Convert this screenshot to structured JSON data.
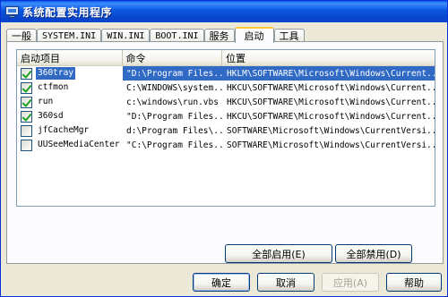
{
  "window": {
    "title": "系统配置实用程序"
  },
  "tabs": [
    {
      "label": "一般"
    },
    {
      "label": "SYSTEM.INI"
    },
    {
      "label": "WIN.INI"
    },
    {
      "label": "BOOT.INI"
    },
    {
      "label": "服务"
    },
    {
      "label": "启动",
      "active": true
    },
    {
      "label": "工具"
    }
  ],
  "startup": {
    "columns": {
      "item": "启动项目",
      "command": "命令",
      "location": "位置"
    },
    "rows": [
      {
        "item": "360tray",
        "checked": true,
        "selected": true,
        "command": "\"D:\\Program Files...",
        "location": "HKLM\\SOFTWARE\\Microsoft\\Windows\\Current..."
      },
      {
        "item": "ctfmon",
        "checked": true,
        "selected": false,
        "command": "C:\\WINDOWS\\system...",
        "location": "HKCU\\SOFTWARE\\Microsoft\\Windows\\Current..."
      },
      {
        "item": "run",
        "checked": true,
        "selected": false,
        "command": "c:\\windows\\run.vbs",
        "location": "HKCU\\SOFTWARE\\Microsoft\\Windows\\Current..."
      },
      {
        "item": "360sd",
        "checked": true,
        "selected": false,
        "command": "\"D:\\Program Files...",
        "location": "HKCU\\SOFTWARE\\Microsoft\\Windows\\Current..."
      },
      {
        "item": "jfCacheMgr",
        "checked": false,
        "selected": false,
        "command": "d:\\Program Files\\...",
        "location": "SOFTWARE\\Microsoft\\Windows\\CurrentVersi..."
      },
      {
        "item": "UUSeeMediaCenter",
        "checked": false,
        "selected": false,
        "command": "\"C:\\Program Files...",
        "location": "SOFTWARE\\Microsoft\\Windows\\CurrentVersi..."
      }
    ],
    "enable_all_label": "全部启用(E)",
    "disable_all_label": "全部禁用(D)"
  },
  "footer": {
    "ok_label": "确定",
    "cancel_label": "取消",
    "apply_label": "应用(A)",
    "help_label": "帮助"
  },
  "colors": {
    "selection": "#316ac5",
    "titlebar": "#0a55e0",
    "active_tab_accent": "#ffc83c"
  }
}
